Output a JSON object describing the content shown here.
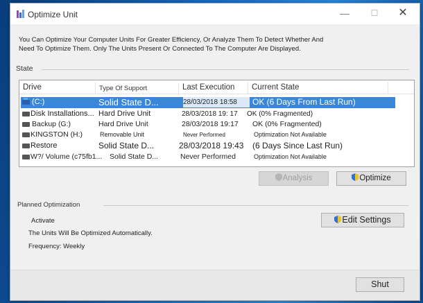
{
  "window": {
    "title": "Optimize Unit",
    "minimize": "—",
    "maximize": "☐",
    "close": "✕"
  },
  "description": {
    "line1": "You Can Optimize Your Computer Units For Greater Efficiency, Or Analyze Them To Detect Whether And",
    "line2": "Need To Optimize Them. Only The Units Present Or Connected To The Computer Are Displayed."
  },
  "state_label": "State",
  "columns": [
    "Drive",
    "Type Of Support",
    "Last Execution",
    "Current State"
  ],
  "drives": [
    {
      "drive": "(C:)",
      "type": "Solid State D...",
      "last": "28/03/2018 18:58",
      "state": "OK (6 Days From Last Run)",
      "selected": true
    },
    {
      "drive": "Disk Installations...",
      "type": "Hard Drive Unit",
      "last": "28/03/2018 19: 17",
      "state": "OK (0% Fragmented)"
    },
    {
      "drive": "Backup (G:)",
      "type": "Hard Drive Unit",
      "last": "28/03/2018 19:17",
      "state": "OK (0% Fragmented)"
    },
    {
      "drive": "KINGSTON (H:)",
      "type": "Removable Unit",
      "last": "Never Performed",
      "state": "Optimization Not Available"
    },
    {
      "drive": "Restore",
      "type": "Solid State D...",
      "last": "28/03/2018 19:43",
      "state": "(6 Days Since Last Run)"
    },
    {
      "drive": "W?/ Volume (c75fb1...",
      "type": "Solid State D...",
      "last": "Never Performed",
      "state": "Optimization Not Available"
    }
  ],
  "buttons": {
    "analyze": "Analysis",
    "optimize": "Optimize",
    "edit_settings": "Edit Settings",
    "shut": "Shut"
  },
  "planned": {
    "label": "Planned Optimization",
    "status": "Activate",
    "auto": "The Units Will Be Optimized Automatically.",
    "frequency": "Frequency: Weekly"
  },
  "colors": {
    "selection": "#3a87d9",
    "shield_blue": "#2f6fd6",
    "shield_yellow": "#f0c419"
  }
}
